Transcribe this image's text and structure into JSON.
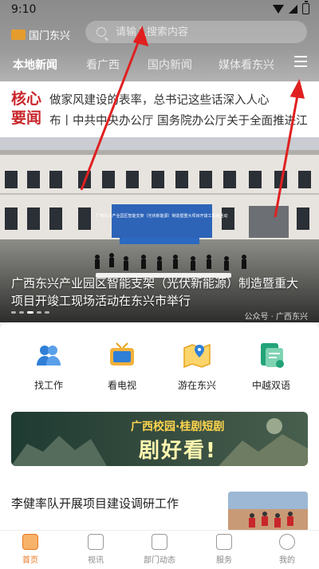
{
  "status": {
    "time": "9:10"
  },
  "header": {
    "logo_text": "国门东兴",
    "search_placeholder": "请输入搜索内容",
    "tabs": [
      {
        "label": "本地新闻",
        "active": true
      },
      {
        "label": "看广西",
        "active": false
      },
      {
        "label": "国内新闻",
        "active": false
      },
      {
        "label": "媒体看东兴",
        "active": false
      }
    ]
  },
  "ticker": {
    "brand_line1": "核心",
    "brand_line2": "要闻",
    "headline1": "做家风建设的表率，总书记这些话深入人心",
    "headline2": "布丨中共中央办公厅 国务院办公厅关于全面推进江"
  },
  "hero": {
    "sign_text": "广西东兴产业园区智能支架（光伏新能源）制造暨重大项目开竣工现场活动",
    "caption": "广西东兴产业园区智能支架（光伏新能源）制造暨重大项目开竣工现场活动在东兴市举行",
    "watermark": "公众号 · 广西东兴"
  },
  "services": [
    {
      "label": "找工作",
      "icon": "people-icon",
      "color": "#2f7fd7"
    },
    {
      "label": "看电视",
      "icon": "tv-icon",
      "color": "#e8a31e"
    },
    {
      "label": "游在东兴",
      "icon": "map-icon",
      "color": "#e8a31e"
    },
    {
      "label": "中越双语",
      "icon": "document-icon",
      "color": "#23a37a"
    }
  ],
  "banner": {
    "line1": "广西校园·桂剧短剧",
    "line2": "剧好看!"
  },
  "article": {
    "title": "李健率队开展项目建设调研工作"
  },
  "nav": [
    {
      "label": "首页",
      "icon": "home-icon",
      "active": true
    },
    {
      "label": "视讯",
      "icon": "video-icon",
      "active": false
    },
    {
      "label": "部门动态",
      "icon": "heart-icon",
      "active": false
    },
    {
      "label": "服务",
      "icon": "grid-icon",
      "active": false
    },
    {
      "label": "我的",
      "icon": "profile-icon",
      "active": false
    }
  ],
  "colors": {
    "brand_red": "#c8262b",
    "accent_orange": "#e8761e",
    "annotation_red": "#e02020"
  }
}
